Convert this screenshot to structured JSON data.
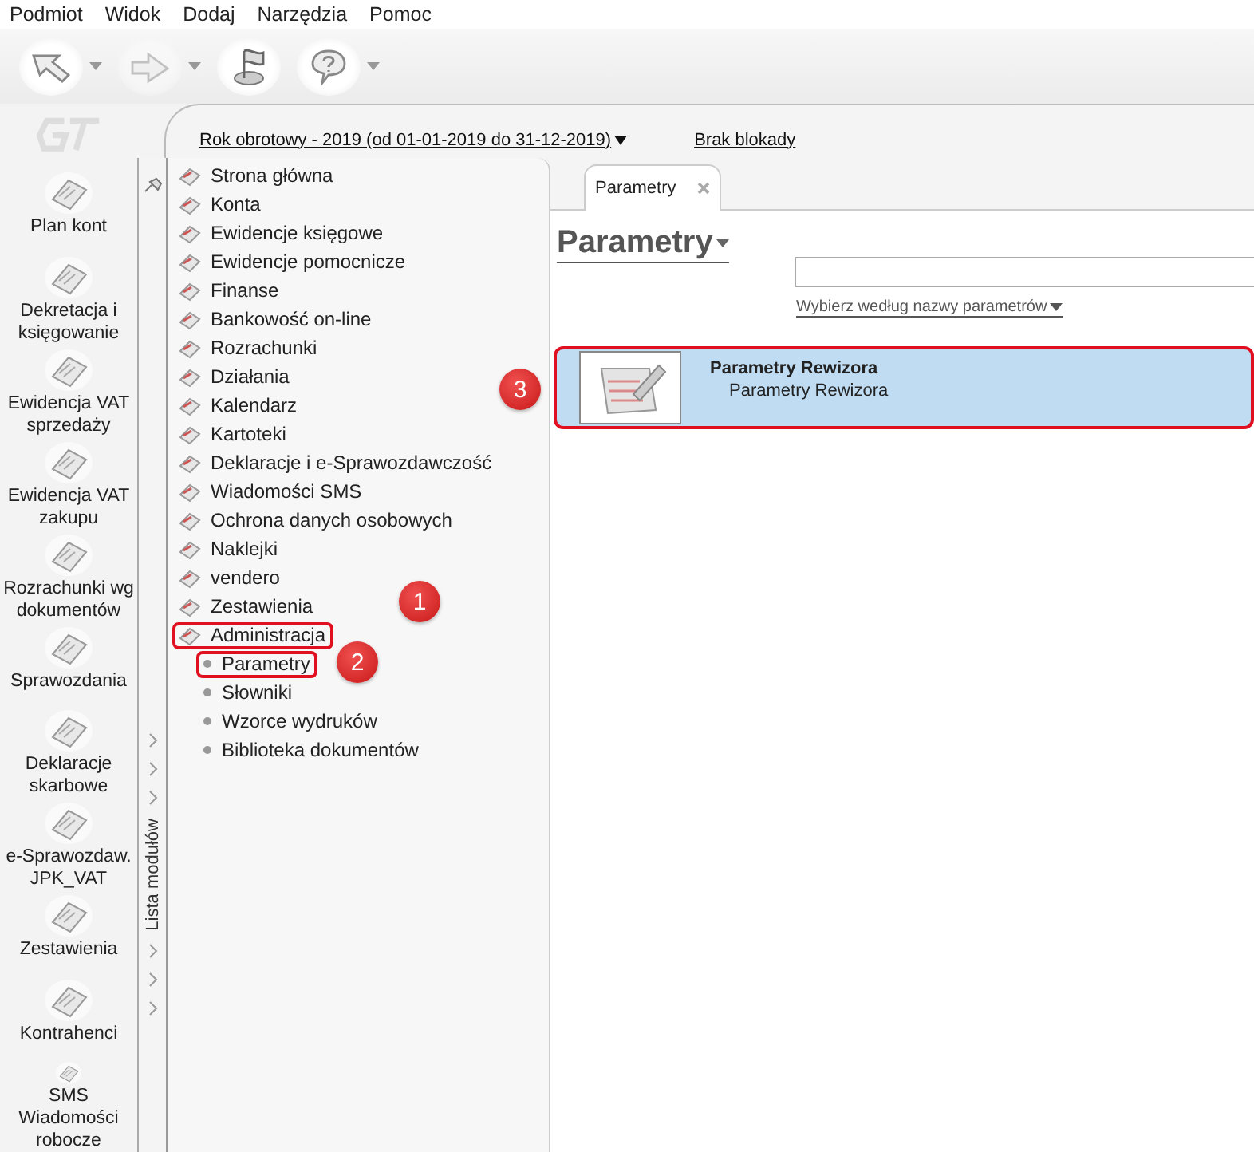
{
  "menu": [
    "Podmiot",
    "Widok",
    "Dodaj",
    "Narzędzia",
    "Pomoc"
  ],
  "toolbar": [
    {
      "dropdown": true,
      "disabled": false
    },
    {
      "dropdown": true,
      "disabled": true
    },
    {
      "dropdown": false,
      "disabled": false
    },
    {
      "dropdown": true,
      "disabled": false
    }
  ],
  "side_modules": [
    "Plan kont",
    "Dekretacja i księgowanie",
    "Ewidencja VAT sprzedaży",
    "Ewidencja VAT zakupu",
    "Rozrachunki wg dokumentów",
    "Sprawozdania",
    "Deklaracje skarbowe",
    "e-Sprawozdaw. JPK_VAT",
    "Zestawienia",
    "Kontrahenci",
    "SMS Wiadomości robocze"
  ],
  "header": {
    "fiscal_year": "Rok obrotowy - 2019  (od 01-01-2019 do 31-12-2019)",
    "lock": "Brak blokady"
  },
  "module_strip": {
    "label": "Lista modułów"
  },
  "tree": [
    {
      "label": "Strona główna",
      "highlighted": false
    },
    {
      "label": "Konta",
      "highlighted": false
    },
    {
      "label": "Ewidencje księgowe",
      "highlighted": false
    },
    {
      "label": "Ewidencje pomocnicze",
      "highlighted": false
    },
    {
      "label": "Finanse",
      "highlighted": false
    },
    {
      "label": "Bankowość on-line",
      "highlighted": false
    },
    {
      "label": "Rozrachunki",
      "highlighted": false
    },
    {
      "label": "Działania",
      "highlighted": false
    },
    {
      "label": "Kalendarz",
      "highlighted": false
    },
    {
      "label": "Kartoteki",
      "highlighted": false
    },
    {
      "label": "Deklaracje i e-Sprawozdawczość",
      "highlighted": false
    },
    {
      "label": "Wiadomości SMS",
      "highlighted": false
    },
    {
      "label": "Ochrona danych osobowych",
      "highlighted": false
    },
    {
      "label": "Naklejki",
      "highlighted": false
    },
    {
      "label": "vendero",
      "highlighted": false
    },
    {
      "label": "Zestawienia",
      "highlighted": false
    },
    {
      "label": "Administracja",
      "highlighted": true,
      "callout": "1",
      "children": [
        {
          "label": "Parametry",
          "highlighted": true,
          "callout": "2"
        },
        {
          "label": "Słowniki",
          "highlighted": false
        },
        {
          "label": "Wzorce wydruków",
          "highlighted": false
        },
        {
          "label": "Biblioteka dokumentów",
          "highlighted": false
        }
      ]
    }
  ],
  "tabs": [
    {
      "label": "Parametry",
      "selected": true
    }
  ],
  "page": {
    "title": "Parametry",
    "filter": "Wybierz według nazwy parametrów"
  },
  "results": [
    {
      "title": "Parametry Rewizora",
      "subtitle": "Parametry Rewizora",
      "selected": true,
      "highlighted": true,
      "callout": "3"
    }
  ]
}
